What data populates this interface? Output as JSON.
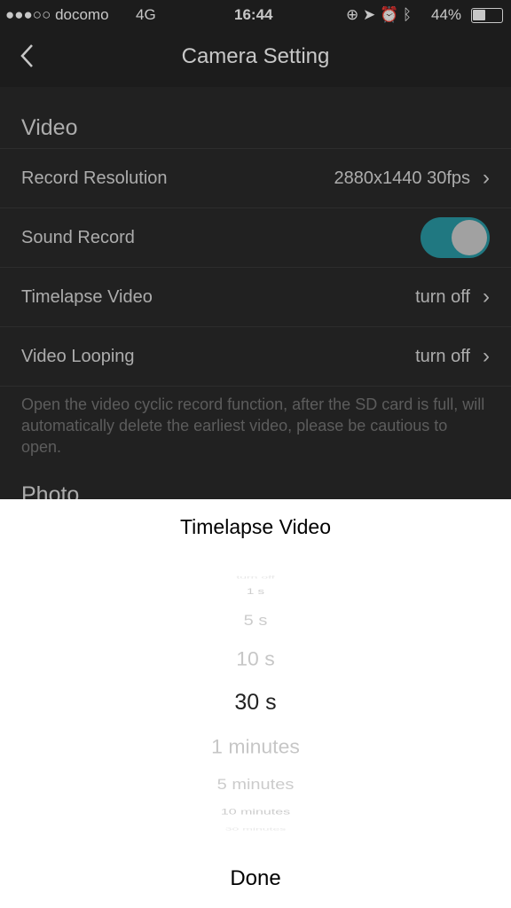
{
  "status": {
    "carrier": "●●●○○ docomo",
    "network": "4G",
    "time": "16:44",
    "battery": "44%",
    "icons": [
      "orientation-lock-icon",
      "location-icon",
      "alarm-icon",
      "bluetooth-icon",
      "battery-icon"
    ]
  },
  "nav": {
    "title": "Camera Setting",
    "back_icon": "chevron-left-icon"
  },
  "video": {
    "header": "Video",
    "rows": [
      {
        "label": "Record Resolution",
        "value": "2880x1440 30fps"
      },
      {
        "label": "Sound Record",
        "toggle": true
      },
      {
        "label": "Timelapse Video",
        "value": "turn off"
      },
      {
        "label": "Video Looping",
        "value": "turn off"
      }
    ],
    "description": "Open the video cyclic record function, after the SD card is full, will automatically delete the earliest video, please be cautious to open."
  },
  "photo": {
    "header": "Photo"
  },
  "colors": {
    "toggle_on": "#2a9aa6"
  },
  "picker": {
    "title": "Timelapse Video",
    "options": [
      "turn off",
      "1 s",
      "5 s",
      "10 s",
      "30 s",
      "1 minutes",
      "5 minutes",
      "10 minutes",
      "30 minutes"
    ],
    "selected": "30 s",
    "done": "Done"
  }
}
